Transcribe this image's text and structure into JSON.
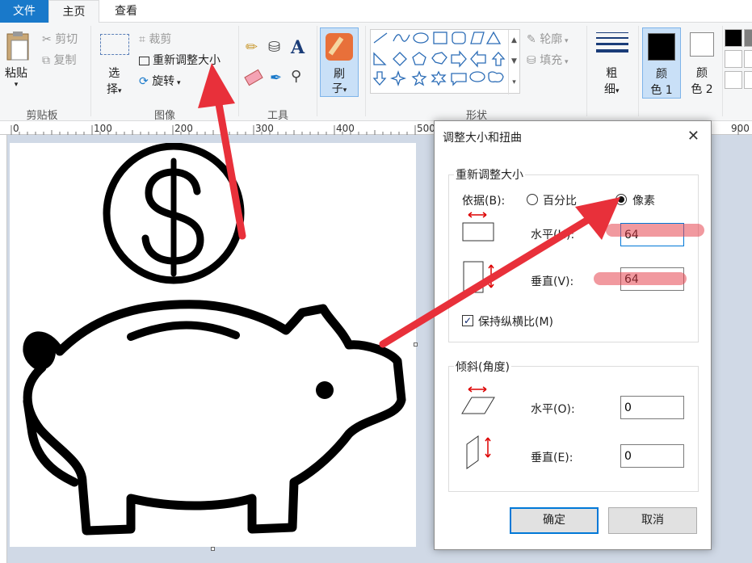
{
  "tabs": {
    "file": "文件",
    "home": "主页",
    "view": "查看"
  },
  "ribbon": {
    "clipboard": {
      "paste": "粘贴",
      "cut": "剪切",
      "copy": "复制",
      "group": "剪贴板"
    },
    "image": {
      "select_1": "选",
      "select_2": "择",
      "crop": "裁剪",
      "resize": "重新调整大小",
      "rotate": "旋转",
      "group": "图像"
    },
    "tools": {
      "group": "工具"
    },
    "brushes": {
      "label_1": "刷",
      "label_2": "子"
    },
    "shapes": {
      "outline": "轮廓",
      "fill": "填充",
      "group": "形状"
    },
    "size": {
      "label_1": "粗",
      "label_2": "细"
    },
    "color1": {
      "label_1": "颜",
      "label_2": "色 1",
      "color": "#000000"
    },
    "color2": {
      "label_1": "颜",
      "label_2": "色 2",
      "color": "#ffffff"
    }
  },
  "ruler": {
    "h": [
      "0",
      "100",
      "200",
      "300",
      "400",
      "500",
      "900"
    ]
  },
  "dialog": {
    "title": "调整大小和扭曲",
    "resize": {
      "group": "重新调整大小",
      "by_label": "依据(B):",
      "percent": "百分比",
      "pixels": "像素",
      "horizontal_label": "水平(H):",
      "horizontal_value": "64",
      "vertical_label": "垂直(V):",
      "vertical_value": "64",
      "keep_ratio": "保持纵横比(M)"
    },
    "skew": {
      "group": "倾斜(角度)",
      "horizontal_label": "水平(O):",
      "horizontal_value": "0",
      "vertical_label": "垂直(E):",
      "vertical_value": "0"
    },
    "ok": "确定",
    "cancel": "取消"
  },
  "colors": {
    "accent": "#1979ca",
    "annotation": "#e8303a"
  }
}
